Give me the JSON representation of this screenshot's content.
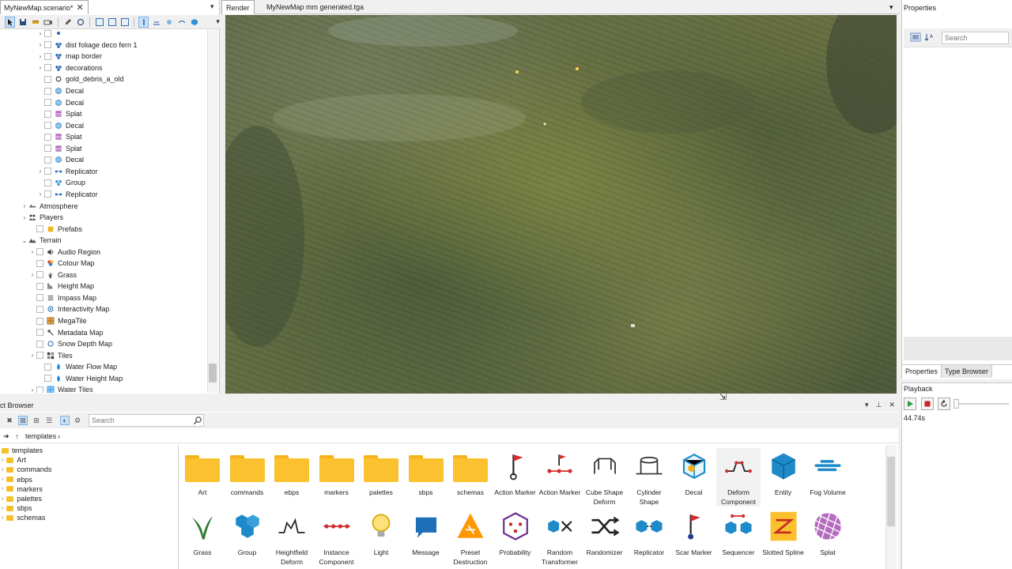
{
  "scene_panel": {
    "tab_label": "MyNewMap.scenario*",
    "close_glyph": "✕",
    "menu_glyph": "▾",
    "tree": [
      {
        "label": "",
        "depth": 3,
        "arrow": "›",
        "icon": "branch-icon",
        "partial": true
      },
      {
        "label": "dist foliage deco fern 1",
        "depth": 3,
        "arrow": "›",
        "icon": "cluster-icon"
      },
      {
        "label": "map border",
        "depth": 3,
        "arrow": "›",
        "icon": "cluster-icon"
      },
      {
        "label": "decorations",
        "depth": 3,
        "arrow": "›",
        "icon": "cluster-icon"
      },
      {
        "label": "gold_debris_a_old",
        "depth": 3,
        "arrow": "",
        "icon": "gear-icon"
      },
      {
        "label": "Decal",
        "depth": 3,
        "arrow": "",
        "icon": "decal-icon"
      },
      {
        "label": "Decal",
        "depth": 3,
        "arrow": "",
        "icon": "decal-icon"
      },
      {
        "label": "Splat",
        "depth": 3,
        "arrow": "",
        "icon": "splat-icon"
      },
      {
        "label": "Decal",
        "depth": 3,
        "arrow": "",
        "icon": "decal-icon"
      },
      {
        "label": "Splat",
        "depth": 3,
        "arrow": "",
        "icon": "splat-icon"
      },
      {
        "label": "Splat",
        "depth": 3,
        "arrow": "",
        "icon": "splat-icon"
      },
      {
        "label": "Decal",
        "depth": 3,
        "arrow": "",
        "icon": "decal-icon"
      },
      {
        "label": "Replicator",
        "depth": 3,
        "arrow": "›",
        "icon": "replicator-icon"
      },
      {
        "label": "Group",
        "depth": 3,
        "arrow": "",
        "icon": "group-icon"
      },
      {
        "label": "Replicator",
        "depth": 3,
        "arrow": "›",
        "icon": "replicator-icon"
      },
      {
        "label": "Atmosphere",
        "depth": 1,
        "arrow": "›",
        "icon": "atmosphere-icon"
      },
      {
        "label": "Players",
        "depth": 1,
        "arrow": "›",
        "icon": "players-icon"
      },
      {
        "label": "Prefabs",
        "depth": 2,
        "arrow": "",
        "icon": "prefab-icon"
      },
      {
        "label": "Terrain",
        "depth": 1,
        "arrow": "⌄",
        "icon": "terrain-icon"
      },
      {
        "label": "Audio Region",
        "depth": 2,
        "arrow": "›",
        "icon": "audio-icon"
      },
      {
        "label": "Colour Map",
        "depth": 2,
        "arrow": "",
        "icon": "colour-map-icon"
      },
      {
        "label": "Grass",
        "depth": 2,
        "arrow": "›",
        "icon": "grass-icon"
      },
      {
        "label": "Height Map",
        "depth": 2,
        "arrow": "",
        "icon": "height-map-icon"
      },
      {
        "label": "Impass Map",
        "depth": 2,
        "arrow": "",
        "icon": "impass-icon"
      },
      {
        "label": "Interactivity Map",
        "depth": 2,
        "arrow": "",
        "icon": "interactivity-icon"
      },
      {
        "label": "MegaTile",
        "depth": 2,
        "arrow": "",
        "icon": "megatile-icon"
      },
      {
        "label": "Metadata Map",
        "depth": 2,
        "arrow": "",
        "icon": "metadata-icon"
      },
      {
        "label": "Snow Depth Map",
        "depth": 2,
        "arrow": "",
        "icon": "snow-icon"
      },
      {
        "label": "Tiles",
        "depth": 2,
        "arrow": "›",
        "icon": "tiles-icon"
      },
      {
        "label": "Water Flow Map",
        "depth": 3,
        "arrow": "",
        "icon": "water-icon"
      },
      {
        "label": "Water Height Map",
        "depth": 3,
        "arrow": "",
        "icon": "water-icon"
      },
      {
        "label": "Water Tiles",
        "depth": 2,
        "arrow": "›",
        "icon": "water-tiles-icon"
      }
    ]
  },
  "viewport": {
    "tabs": [
      "Render",
      "MyNewMap mm generated.tga"
    ],
    "menu_glyph": "▾"
  },
  "properties": {
    "title": "Properties",
    "search_placeholder": "Search",
    "tabs": [
      "Properties",
      "Type Browser"
    ]
  },
  "playback": {
    "title": "Playback",
    "time": "44.74s",
    "progress": 0.0
  },
  "content_browser": {
    "title": "ct Browser",
    "controls": [
      "▾",
      "⊥",
      "✕"
    ],
    "search_placeholder": "Search",
    "breadcrumb": [
      "templates",
      "›"
    ],
    "folder_tree": [
      {
        "label": "templates",
        "depth": 0
      },
      {
        "label": "Art",
        "depth": 1
      },
      {
        "label": "commands",
        "depth": 1
      },
      {
        "label": "ebps",
        "depth": 1
      },
      {
        "label": "markers",
        "depth": 1
      },
      {
        "label": "palettes",
        "depth": 1
      },
      {
        "label": "sbps",
        "depth": 1
      },
      {
        "label": "schemas",
        "depth": 1
      }
    ],
    "assets_row1": [
      {
        "label": "Art",
        "icon": "folder-icon"
      },
      {
        "label": "commands",
        "icon": "folder-icon"
      },
      {
        "label": "ebps",
        "icon": "folder-icon"
      },
      {
        "label": "markers",
        "icon": "folder-icon"
      },
      {
        "label": "palettes",
        "icon": "folder-icon"
      },
      {
        "label": "sbps",
        "icon": "folder-icon"
      },
      {
        "label": "schemas",
        "icon": "folder-icon"
      },
      {
        "label": "Action Marker",
        "icon": "action-marker-icon"
      },
      {
        "label": "Action Marker",
        "icon": "action-marker-line-icon"
      },
      {
        "label": "Cube Shape Deform",
        "icon": "cube-shape-deform-icon"
      },
      {
        "label": "Cylinder Shape",
        "icon": "cylinder-shape-icon"
      },
      {
        "label": "Decal",
        "icon": "decal-cube-icon"
      },
      {
        "label": "Deform Component",
        "icon": "deform-component-icon"
      },
      {
        "label": "Entity",
        "icon": "entity-icon"
      },
      {
        "label": "Fog Volume",
        "icon": "fog-volume-icon"
      }
    ],
    "assets_row2": [
      {
        "label": "Grass",
        "icon": "grass-asset-icon"
      },
      {
        "label": "Group",
        "icon": "group-cubes-icon"
      },
      {
        "label": "Heightfield Deform",
        "icon": "heightfield-icon"
      },
      {
        "label": "Instance Component",
        "icon": "instance-component-icon"
      },
      {
        "label": "Light",
        "icon": "light-bulb-icon"
      },
      {
        "label": "Message",
        "icon": "message-icon"
      },
      {
        "label": "Preset Destruction",
        "icon": "destruction-icon"
      },
      {
        "label": "Probability",
        "icon": "dice-icon"
      },
      {
        "label": "Random Transformer",
        "icon": "random-transformer-icon"
      },
      {
        "label": "Randomizer",
        "icon": "shuffle-icon"
      },
      {
        "label": "Replicator",
        "icon": "replicator-asset-icon"
      },
      {
        "label": "Scar Marker",
        "icon": "scar-marker-icon"
      },
      {
        "label": "Sequencer",
        "icon": "sequencer-icon"
      },
      {
        "label": "Slotted Spline",
        "icon": "slotted-spline-icon"
      },
      {
        "label": "Splat",
        "icon": "splat-asset-icon"
      }
    ]
  },
  "colors": {
    "folder": "#fcc12e",
    "accent_blue": "#1f8ac9",
    "marker_red": "#d32f2f"
  }
}
